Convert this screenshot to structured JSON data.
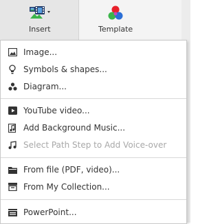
{
  "toolbar": {
    "insert_label": "Insert",
    "template_label": "Template"
  },
  "menu": {
    "items": [
      {
        "label": "Image...",
        "icon": "image-icon",
        "enabled": true
      },
      {
        "label": "Symbols & shapes...",
        "icon": "lightbulb-icon",
        "enabled": true
      },
      {
        "label": "Diagram...",
        "icon": "diagram-icon",
        "enabled": true
      },
      {
        "label": "YouTube video...",
        "icon": "youtube-icon",
        "enabled": true
      },
      {
        "label": "Add Background Music...",
        "icon": "music-note-icon",
        "enabled": true
      },
      {
        "label": "Select Path Step to Add Voice-over",
        "icon": "voice-note-icon",
        "enabled": false
      },
      {
        "label": "From file (PDF, video)...",
        "icon": "folder-icon",
        "enabled": true
      },
      {
        "label": "From My Collection...",
        "icon": "collection-icon",
        "enabled": true
      },
      {
        "label": "PowerPoint...",
        "icon": "powerpoint-icon",
        "enabled": true
      }
    ]
  },
  "colors": {
    "menu_text": "#333333",
    "disabled_text": "#a8a8a8",
    "template_red": "#e8212b",
    "template_green": "#3bb54a",
    "template_blue": "#2b6fd6",
    "insert_icon": "#1f3a6a"
  }
}
